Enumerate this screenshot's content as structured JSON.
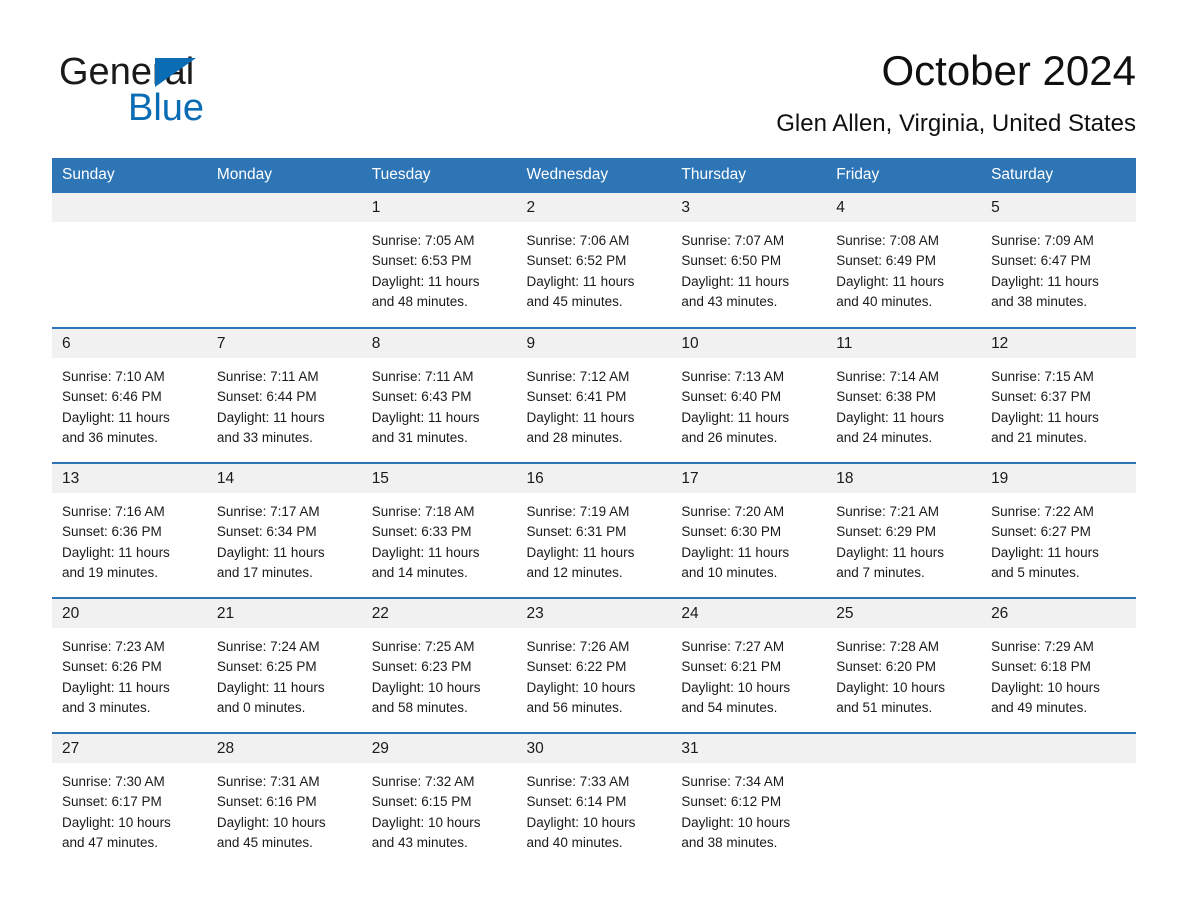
{
  "brand": {
    "name_dark": "General",
    "name_light": "Blue",
    "triangle_color": "#0a6cb4"
  },
  "header": {
    "title": "October 2024",
    "subtitle": "Glen Allen, Virginia, United States"
  },
  "theme": {
    "header_blue": "#2e75b6",
    "band_gray": "#f1f1f1",
    "text": "#1a1a1a",
    "page_background": "#ffffff"
  },
  "weekdays": [
    "Sunday",
    "Monday",
    "Tuesday",
    "Wednesday",
    "Thursday",
    "Friday",
    "Saturday"
  ],
  "weeks": [
    [
      {
        "day": "",
        "sunrise": "",
        "sunset": "",
        "daylight_1": "",
        "daylight_2": "",
        "empty": true
      },
      {
        "day": "",
        "sunrise": "",
        "sunset": "",
        "daylight_1": "",
        "daylight_2": "",
        "empty": true
      },
      {
        "day": "1",
        "sunrise": "Sunrise: 7:05 AM",
        "sunset": "Sunset: 6:53 PM",
        "daylight_1": "Daylight: 11 hours",
        "daylight_2": "and 48 minutes.",
        "empty": false
      },
      {
        "day": "2",
        "sunrise": "Sunrise: 7:06 AM",
        "sunset": "Sunset: 6:52 PM",
        "daylight_1": "Daylight: 11 hours",
        "daylight_2": "and 45 minutes.",
        "empty": false
      },
      {
        "day": "3",
        "sunrise": "Sunrise: 7:07 AM",
        "sunset": "Sunset: 6:50 PM",
        "daylight_1": "Daylight: 11 hours",
        "daylight_2": "and 43 minutes.",
        "empty": false
      },
      {
        "day": "4",
        "sunrise": "Sunrise: 7:08 AM",
        "sunset": "Sunset: 6:49 PM",
        "daylight_1": "Daylight: 11 hours",
        "daylight_2": "and 40 minutes.",
        "empty": false
      },
      {
        "day": "5",
        "sunrise": "Sunrise: 7:09 AM",
        "sunset": "Sunset: 6:47 PM",
        "daylight_1": "Daylight: 11 hours",
        "daylight_2": "and 38 minutes.",
        "empty": false
      }
    ],
    [
      {
        "day": "6",
        "sunrise": "Sunrise: 7:10 AM",
        "sunset": "Sunset: 6:46 PM",
        "daylight_1": "Daylight: 11 hours",
        "daylight_2": "and 36 minutes.",
        "empty": false
      },
      {
        "day": "7",
        "sunrise": "Sunrise: 7:11 AM",
        "sunset": "Sunset: 6:44 PM",
        "daylight_1": "Daylight: 11 hours",
        "daylight_2": "and 33 minutes.",
        "empty": false
      },
      {
        "day": "8",
        "sunrise": "Sunrise: 7:11 AM",
        "sunset": "Sunset: 6:43 PM",
        "daylight_1": "Daylight: 11 hours",
        "daylight_2": "and 31 minutes.",
        "empty": false
      },
      {
        "day": "9",
        "sunrise": "Sunrise: 7:12 AM",
        "sunset": "Sunset: 6:41 PM",
        "daylight_1": "Daylight: 11 hours",
        "daylight_2": "and 28 minutes.",
        "empty": false
      },
      {
        "day": "10",
        "sunrise": "Sunrise: 7:13 AM",
        "sunset": "Sunset: 6:40 PM",
        "daylight_1": "Daylight: 11 hours",
        "daylight_2": "and 26 minutes.",
        "empty": false
      },
      {
        "day": "11",
        "sunrise": "Sunrise: 7:14 AM",
        "sunset": "Sunset: 6:38 PM",
        "daylight_1": "Daylight: 11 hours",
        "daylight_2": "and 24 minutes.",
        "empty": false
      },
      {
        "day": "12",
        "sunrise": "Sunrise: 7:15 AM",
        "sunset": "Sunset: 6:37 PM",
        "daylight_1": "Daylight: 11 hours",
        "daylight_2": "and 21 minutes.",
        "empty": false
      }
    ],
    [
      {
        "day": "13",
        "sunrise": "Sunrise: 7:16 AM",
        "sunset": "Sunset: 6:36 PM",
        "daylight_1": "Daylight: 11 hours",
        "daylight_2": "and 19 minutes.",
        "empty": false
      },
      {
        "day": "14",
        "sunrise": "Sunrise: 7:17 AM",
        "sunset": "Sunset: 6:34 PM",
        "daylight_1": "Daylight: 11 hours",
        "daylight_2": "and 17 minutes.",
        "empty": false
      },
      {
        "day": "15",
        "sunrise": "Sunrise: 7:18 AM",
        "sunset": "Sunset: 6:33 PM",
        "daylight_1": "Daylight: 11 hours",
        "daylight_2": "and 14 minutes.",
        "empty": false
      },
      {
        "day": "16",
        "sunrise": "Sunrise: 7:19 AM",
        "sunset": "Sunset: 6:31 PM",
        "daylight_1": "Daylight: 11 hours",
        "daylight_2": "and 12 minutes.",
        "empty": false
      },
      {
        "day": "17",
        "sunrise": "Sunrise: 7:20 AM",
        "sunset": "Sunset: 6:30 PM",
        "daylight_1": "Daylight: 11 hours",
        "daylight_2": "and 10 minutes.",
        "empty": false
      },
      {
        "day": "18",
        "sunrise": "Sunrise: 7:21 AM",
        "sunset": "Sunset: 6:29 PM",
        "daylight_1": "Daylight: 11 hours",
        "daylight_2": "and 7 minutes.",
        "empty": false
      },
      {
        "day": "19",
        "sunrise": "Sunrise: 7:22 AM",
        "sunset": "Sunset: 6:27 PM",
        "daylight_1": "Daylight: 11 hours",
        "daylight_2": "and 5 minutes.",
        "empty": false
      }
    ],
    [
      {
        "day": "20",
        "sunrise": "Sunrise: 7:23 AM",
        "sunset": "Sunset: 6:26 PM",
        "daylight_1": "Daylight: 11 hours",
        "daylight_2": "and 3 minutes.",
        "empty": false
      },
      {
        "day": "21",
        "sunrise": "Sunrise: 7:24 AM",
        "sunset": "Sunset: 6:25 PM",
        "daylight_1": "Daylight: 11 hours",
        "daylight_2": "and 0 minutes.",
        "empty": false
      },
      {
        "day": "22",
        "sunrise": "Sunrise: 7:25 AM",
        "sunset": "Sunset: 6:23 PM",
        "daylight_1": "Daylight: 10 hours",
        "daylight_2": "and 58 minutes.",
        "empty": false
      },
      {
        "day": "23",
        "sunrise": "Sunrise: 7:26 AM",
        "sunset": "Sunset: 6:22 PM",
        "daylight_1": "Daylight: 10 hours",
        "daylight_2": "and 56 minutes.",
        "empty": false
      },
      {
        "day": "24",
        "sunrise": "Sunrise: 7:27 AM",
        "sunset": "Sunset: 6:21 PM",
        "daylight_1": "Daylight: 10 hours",
        "daylight_2": "and 54 minutes.",
        "empty": false
      },
      {
        "day": "25",
        "sunrise": "Sunrise: 7:28 AM",
        "sunset": "Sunset: 6:20 PM",
        "daylight_1": "Daylight: 10 hours",
        "daylight_2": "and 51 minutes.",
        "empty": false
      },
      {
        "day": "26",
        "sunrise": "Sunrise: 7:29 AM",
        "sunset": "Sunset: 6:18 PM",
        "daylight_1": "Daylight: 10 hours",
        "daylight_2": "and 49 minutes.",
        "empty": false
      }
    ],
    [
      {
        "day": "27",
        "sunrise": "Sunrise: 7:30 AM",
        "sunset": "Sunset: 6:17 PM",
        "daylight_1": "Daylight: 10 hours",
        "daylight_2": "and 47 minutes.",
        "empty": false
      },
      {
        "day": "28",
        "sunrise": "Sunrise: 7:31 AM",
        "sunset": "Sunset: 6:16 PM",
        "daylight_1": "Daylight: 10 hours",
        "daylight_2": "and 45 minutes.",
        "empty": false
      },
      {
        "day": "29",
        "sunrise": "Sunrise: 7:32 AM",
        "sunset": "Sunset: 6:15 PM",
        "daylight_1": "Daylight: 10 hours",
        "daylight_2": "and 43 minutes.",
        "empty": false
      },
      {
        "day": "30",
        "sunrise": "Sunrise: 7:33 AM",
        "sunset": "Sunset: 6:14 PM",
        "daylight_1": "Daylight: 10 hours",
        "daylight_2": "and 40 minutes.",
        "empty": false
      },
      {
        "day": "31",
        "sunrise": "Sunrise: 7:34 AM",
        "sunset": "Sunset: 6:12 PM",
        "daylight_1": "Daylight: 10 hours",
        "daylight_2": "and 38 minutes.",
        "empty": false
      },
      {
        "day": "",
        "sunrise": "",
        "sunset": "",
        "daylight_1": "",
        "daylight_2": "",
        "empty": true
      },
      {
        "day": "",
        "sunrise": "",
        "sunset": "",
        "daylight_1": "",
        "daylight_2": "",
        "empty": true
      }
    ]
  ]
}
